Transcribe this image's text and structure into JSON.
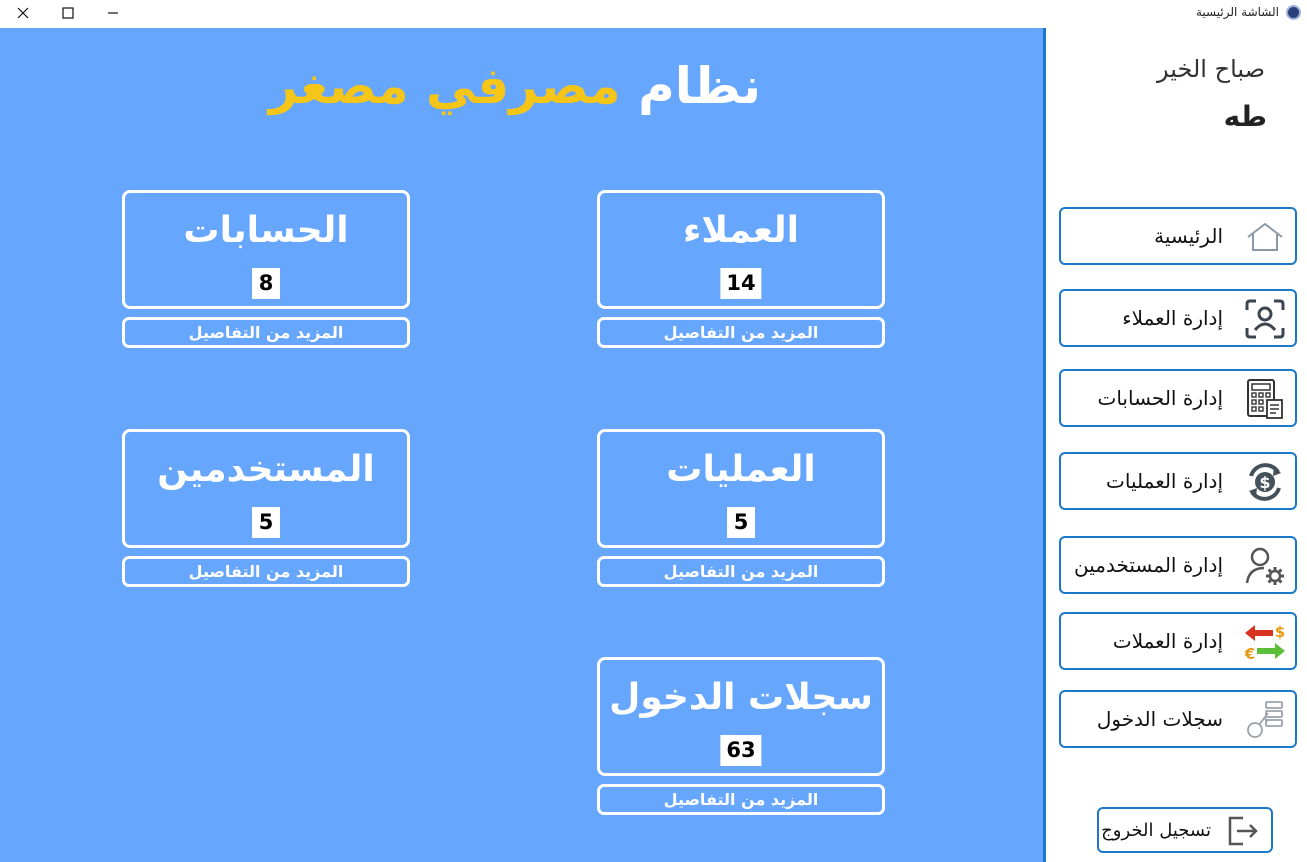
{
  "window": {
    "title": "الشاشة الرئيسية",
    "controls": [
      "close",
      "maximize",
      "minimize"
    ]
  },
  "header": {
    "title_word1": "نظام",
    "title_word2": "مصرفي مصغر",
    "title_color1": "#ffffff",
    "title_color2": "#f5c518"
  },
  "cards": [
    {
      "key": "clients",
      "title": "العملاء",
      "count": "14",
      "more": "المزيد من التفاصيل"
    },
    {
      "key": "accounts",
      "title": "الحسابات",
      "count": "8",
      "more": "المزيد من التفاصيل"
    },
    {
      "key": "operations",
      "title": "العمليات",
      "count": "5",
      "more": "المزيد من التفاصيل"
    },
    {
      "key": "users",
      "title": "المستخدمين",
      "count": "5",
      "more": "المزيد من التفاصيل"
    },
    {
      "key": "logs",
      "title": "سجلات الدخول",
      "count": "63",
      "more": "المزيد من التفاصيل"
    }
  ],
  "sidebar": {
    "greeting": "صباح الخير",
    "username": "طه",
    "items": [
      {
        "label": "الرئيسية",
        "icon": "home-icon"
      },
      {
        "label": "إدارة العملاء",
        "icon": "face-scan-icon"
      },
      {
        "label": "إدارة الحسابات",
        "icon": "calculator-icon"
      },
      {
        "label": "إدارة العمليات",
        "icon": "dollar-cycle-icon"
      },
      {
        "label": "إدارة المستخدمين",
        "icon": "user-gear-icon"
      },
      {
        "label": "إدارة العملات",
        "icon": "currency-exchange-icon"
      },
      {
        "label": "سجلات الدخول",
        "icon": "key-log-icon"
      }
    ],
    "logout_label": "تسجيل الخروج",
    "accent": "#1c78c8"
  },
  "colors": {
    "main_bg": "#66a6fd",
    "card_border": "#ffffff"
  }
}
